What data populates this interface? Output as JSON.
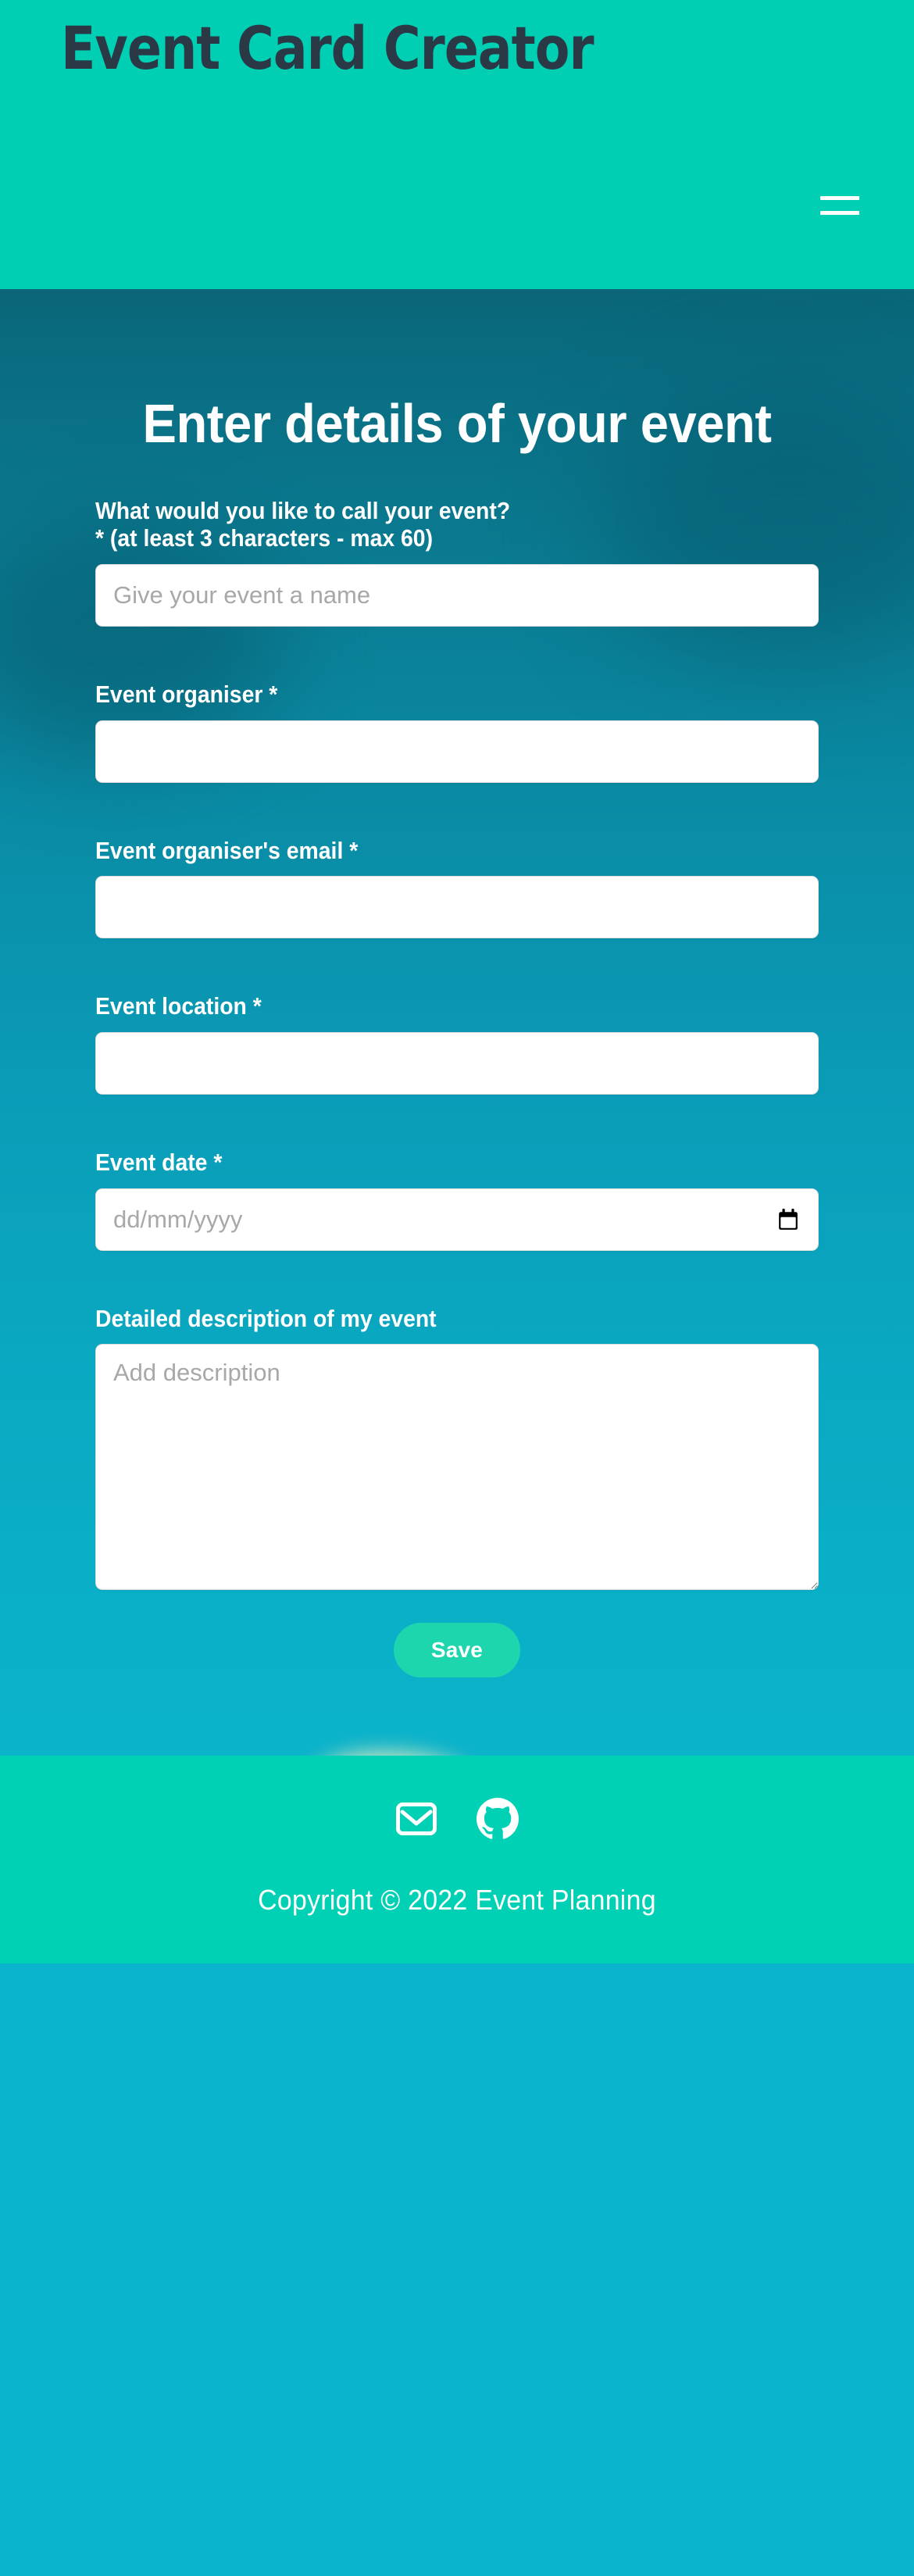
{
  "header": {
    "brand_title": "Event Card Creator",
    "nav_toggle_label": "Menu",
    "background_color": "#00cfb4",
    "title_color": "#2b3947"
  },
  "main": {
    "heading": "Enter details of your event",
    "fields": [
      {
        "id": "event-name",
        "label": "What would you like to call your event?\n* (at least 3 characters - max 60)",
        "placeholder": "Give your event a name",
        "value": ""
      },
      {
        "id": "event-organiser",
        "label": "Event organiser *",
        "placeholder": "",
        "value": ""
      },
      {
        "id": "event-organiser-email",
        "label": "Event organiser's email *",
        "placeholder": "",
        "value": ""
      },
      {
        "id": "event-location",
        "label": "Event location *",
        "placeholder": "",
        "value": ""
      },
      {
        "id": "event-date",
        "label": "Event date *",
        "placeholder": "dd/mm/yyyy",
        "value": ""
      },
      {
        "id": "event-description",
        "label": "Detailed description of my event",
        "placeholder": "Add description",
        "value": ""
      }
    ],
    "save_label": "Save",
    "save_color": "#1ed6ae"
  },
  "footer": {
    "background_color": "#00d1b4",
    "social": [
      {
        "name": "email-icon",
        "label": "Email"
      },
      {
        "name": "github-icon",
        "label": "GitHub"
      }
    ],
    "copyright": "Copyright © 2022 Event Planning"
  }
}
